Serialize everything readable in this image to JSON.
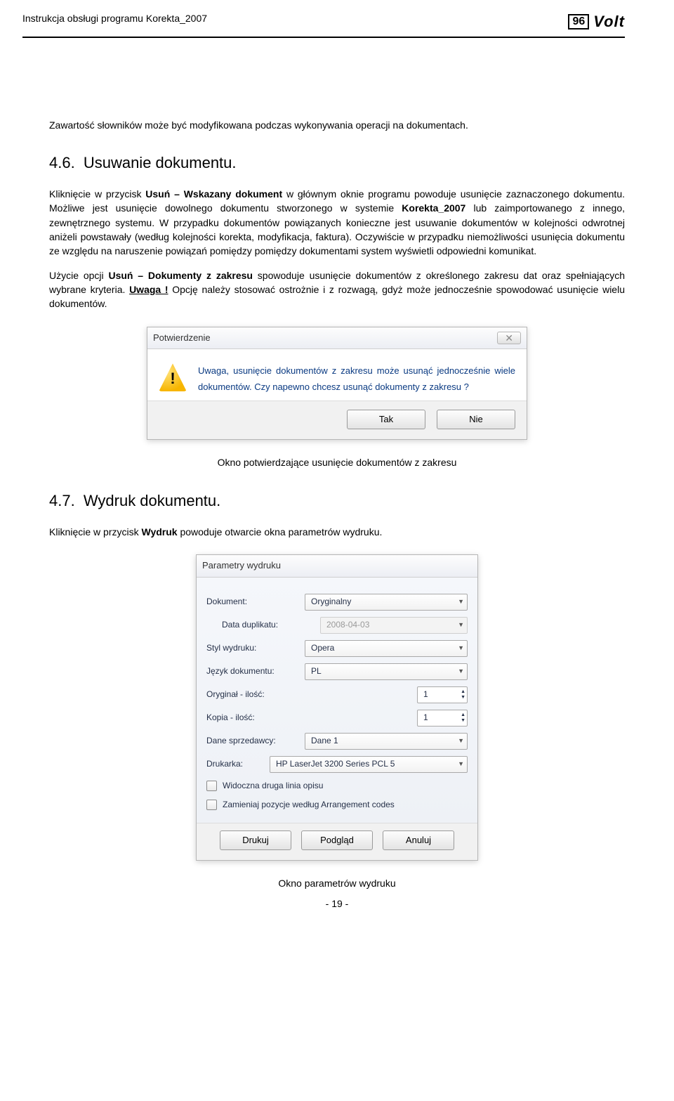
{
  "header": {
    "title": "Instrukcja obsługi programu Korekta_2007",
    "brand_96": "96",
    "brand_volt": "Volt"
  },
  "text": {
    "p1": "Zawartość słowników może być modyfikowana podczas wykonywania operacji na dokumentach.",
    "h46_num": "4.6.",
    "h46_title": "Usuwanie dokumentu.",
    "p2a": "Kliknięcie w przycisk ",
    "p2b": "Usuń – Wskazany dokument",
    "p2c": " w głównym oknie programu powoduje usunięcie zaznaczonego dokumentu. Możliwe jest usunięcie dowolnego dokumentu stworzonego w systemie ",
    "p2d": "Korekta_2007",
    "p2e": " lub zaimportowanego z innego, zewnętrznego systemu.",
    "p3": "W przypadku dokumentów powiązanych konieczne jest usuwanie dokumentów w kolejności odwrotnej aniżeli powstawały (według kolejności korekta, modyfikacja, faktura). Oczywiście w przypadku niemożliwości usunięcia dokumentu ze względu na naruszenie powiązań pomiędzy pomiędzy dokumentami system wyświetli odpowiedni komunikat.",
    "p4a": "Użycie opcji ",
    "p4b": "Usuń – Dokumenty z zakresu",
    "p4c": " spowoduje usunięcie dokumentów z określonego zakresu dat oraz spełniających wybrane kryteria. ",
    "p4d": "Uwaga !",
    "p4e": " Opcję należy stosować ostrożnie i z rozwagą, gdyż może jednocześnie spowodować usunięcie wielu dokumentów.",
    "caption1": "Okno potwierdzające usunięcie dokumentów z zakresu",
    "h47_num": "4.7.",
    "h47_title": "Wydruk dokumentu.",
    "p5a": "Kliknięcie w przycisk ",
    "p5b": "Wydruk",
    "p5c": " powoduje otwarcie okna parametrów wydruku.",
    "caption2": "Okno parametrów wydruku",
    "page": "- 19 -"
  },
  "dialog1": {
    "title": "Potwierdzenie",
    "body": "Uwaga, usunięcie dokumentów z zakresu może usunąć jednocześnie wiele dokumentów. Czy napewno chcesz usunąć dokumenty z zakresu ?",
    "yes": "Tak",
    "no": "Nie",
    "close": "✕"
  },
  "dialog2": {
    "title": "Parametry wydruku",
    "rows": {
      "dokument_label": "Dokument:",
      "dokument_value": "Oryginalny",
      "duplikat_label": "Data duplikatu:",
      "duplikat_value": "2008-04-03",
      "styl_label": "Styl wydruku:",
      "styl_value": "Opera",
      "jezyk_label": "Język dokumentu:",
      "jezyk_value": "PL",
      "oryg_label": "Oryginał - ilość:",
      "oryg_value": "1",
      "kopia_label": "Kopia - ilość:",
      "kopia_value": "1",
      "sprzed_label": "Dane sprzedawcy:",
      "sprzed_value": "Dane 1",
      "drukarka_label": "Drukarka:",
      "drukarka_value": "HP LaserJet 3200 Series PCL 5"
    },
    "check1": "Widoczna druga linia opisu",
    "check2": "Zamieniaj pozycje według Arrangement codes",
    "btn_print": "Drukuj",
    "btn_preview": "Podgląd",
    "btn_cancel": "Anuluj"
  }
}
